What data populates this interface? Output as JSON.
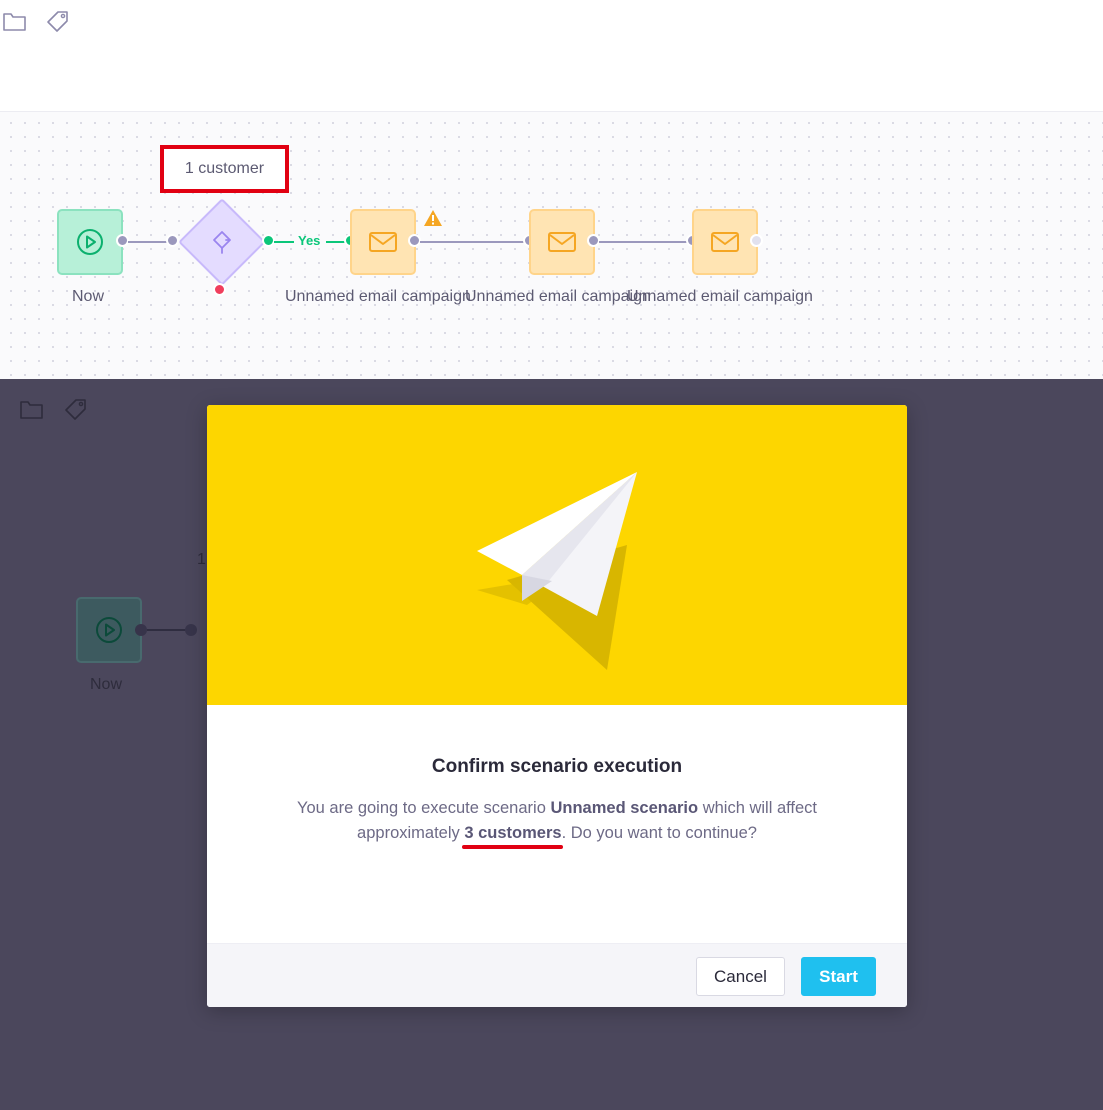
{
  "toolbar": {
    "icons": [
      "folder-icon",
      "tag-icon"
    ]
  },
  "scenario": {
    "count_badge": "1 customer",
    "nodes": {
      "start_label": "Now",
      "email1_label": "Unnamed email campaign",
      "email2_label": "Unnamed email campaign",
      "email3_label": "Unnamed email campaign"
    },
    "yes_label": "Yes"
  },
  "background": {
    "start_label": "Now",
    "partial_text": "1"
  },
  "modal": {
    "title": "Confirm scenario execution",
    "text_part1": "You are going to execute scenario ",
    "scenario_name": "Unnamed scenario",
    "text_part2": " which will affect approximately ",
    "customer_count": "3 customers",
    "text_part3": ". Do you want to continue?",
    "cancel_label": "Cancel",
    "start_label": "Start"
  },
  "colors": {
    "accent": "#1fc0ef",
    "hero": "#fdd600",
    "highlight": "#e10012",
    "success": "#0bc67a"
  }
}
